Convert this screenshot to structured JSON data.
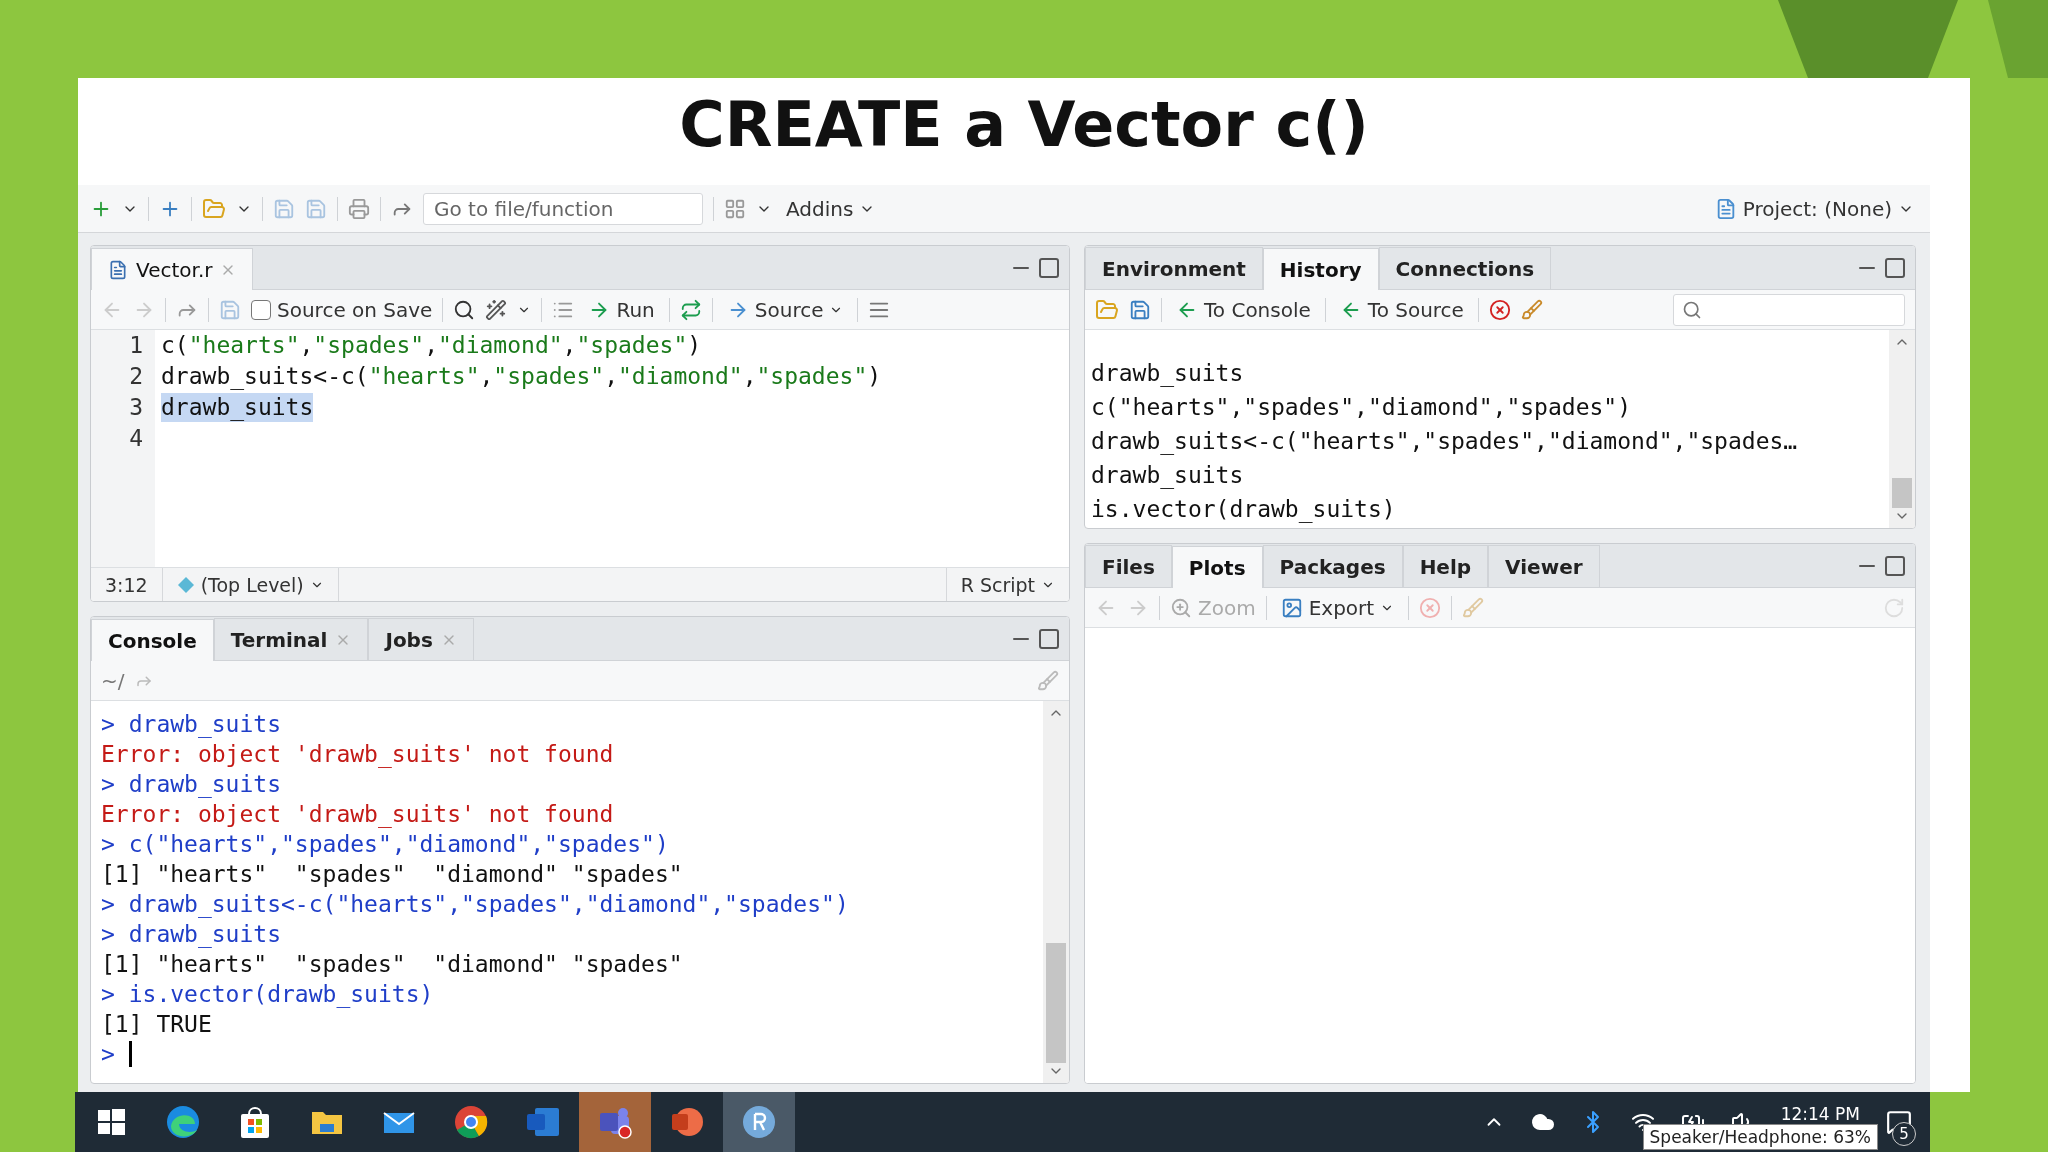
{
  "slide": {
    "title": "CREATE a Vector c()"
  },
  "toolbar": {
    "goto_placeholder": "Go to file/function",
    "addins": "Addins",
    "project": "Project: (None)"
  },
  "editor": {
    "tabs": [
      {
        "label": "Vector.r",
        "selected": true
      }
    ],
    "source_on_save": {
      "label": "Source on Save",
      "checked": false
    },
    "run": "Run",
    "source": "Source",
    "lines": [
      {
        "number": "1",
        "selected": false,
        "text": "c(\"hearts\",\"spades\",\"diamond\",\"spades\")"
      },
      {
        "number": "2",
        "selected": false,
        "text": "drawb_suits<-c(\"hearts\",\"spades\",\"diamond\",\"spades\")"
      },
      {
        "number": "3",
        "selected": true,
        "text": "drawb_suits"
      },
      {
        "number": "4"
      }
    ],
    "status": {
      "position": "3:12",
      "scope": "(Top Level)",
      "type": "R Script"
    }
  },
  "console": {
    "tabs": [
      {
        "label": "Console",
        "selected": true,
        "closable": false
      },
      {
        "label": "Terminal",
        "selected": false,
        "closable": true
      },
      {
        "label": "Jobs",
        "selected": false,
        "closable": true
      }
    ],
    "path": "~/",
    "lines": [
      {
        "kind": "input",
        "text": "> drawb_suits"
      },
      {
        "kind": "error",
        "text": "Error: object 'drawb_suits' not found"
      },
      {
        "kind": "input",
        "text": "> drawb_suits"
      },
      {
        "kind": "error",
        "text": "Error: object 'drawb_suits' not found"
      },
      {
        "kind": "input",
        "text": "> c(\"hearts\",\"spades\",\"diamond\",\"spades\")"
      },
      {
        "kind": "output",
        "text": "[1] \"hearts\"  \"spades\"  \"diamond\" \"spades\""
      },
      {
        "kind": "input",
        "text": "> drawb_suits<-c(\"hearts\",\"spades\",\"diamond\",\"spades\")"
      },
      {
        "kind": "input",
        "text": "> drawb_suits"
      },
      {
        "kind": "output",
        "text": "[1] \"hearts\"  \"spades\"  \"diamond\" \"spades\""
      },
      {
        "kind": "input",
        "text": "> is.vector(drawb_suits)"
      },
      {
        "kind": "output",
        "text": "[1] TRUE"
      },
      {
        "kind": "prompt",
        "text": ">"
      }
    ]
  },
  "history": {
    "tabs": [
      {
        "label": "Environment",
        "selected": false
      },
      {
        "label": "History",
        "selected": true
      },
      {
        "label": "Connections",
        "selected": false
      }
    ],
    "to_console": "To Console",
    "to_source": "To Source",
    "lines": [
      "drawb_suits",
      "c(\"hearts\",\"spades\",\"diamond\",\"spades\")",
      "drawb_suits<-c(\"hearts\",\"spades\",\"diamond\",\"spades…",
      "drawb_suits",
      "is.vector(drawb_suits)"
    ]
  },
  "files": {
    "tabs": [
      {
        "label": "Files",
        "selected": false
      },
      {
        "label": "Plots",
        "selected": true
      },
      {
        "label": "Packages",
        "selected": false
      },
      {
        "label": "Help",
        "selected": false
      },
      {
        "label": "Viewer",
        "selected": false
      }
    ],
    "zoom": "Zoom",
    "export": "Export"
  },
  "taskbar": {
    "apps": [
      {
        "kind": "edge",
        "active": false
      },
      {
        "kind": "store",
        "active": false
      },
      {
        "kind": "folder",
        "active": false
      },
      {
        "kind": "mail",
        "active": false
      },
      {
        "kind": "chrome",
        "active": false
      },
      {
        "kind": "word",
        "active": false
      },
      {
        "kind": "teams",
        "active": true
      },
      {
        "kind": "powerpoint",
        "active": false
      },
      {
        "kind": "rstudio",
        "active": true
      }
    ],
    "time": "12:14 PM",
    "tooltip": "Speaker/Headphone: 63%",
    "notifications": "5"
  }
}
